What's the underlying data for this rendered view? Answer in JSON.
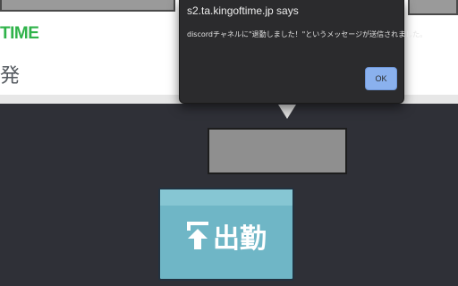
{
  "page": {
    "brand_logo_text": "TIME",
    "brand_subtext": "発"
  },
  "alert": {
    "title": "s2.ta.kingoftime.jp says",
    "message": "discordチャネルに\"退勤しました！\"というメッセージが送信されました。",
    "ok_label": "OK"
  },
  "clock_in": {
    "label": "出勤",
    "icon": "clock-in-arrow-icon"
  },
  "colors": {
    "brand_green": "#2fb34a",
    "dark_background": "#2f3037",
    "button_teal": "#6fb6c6",
    "ok_blue": "#8ab1ee",
    "dialog_bg": "#2b2b2d"
  }
}
